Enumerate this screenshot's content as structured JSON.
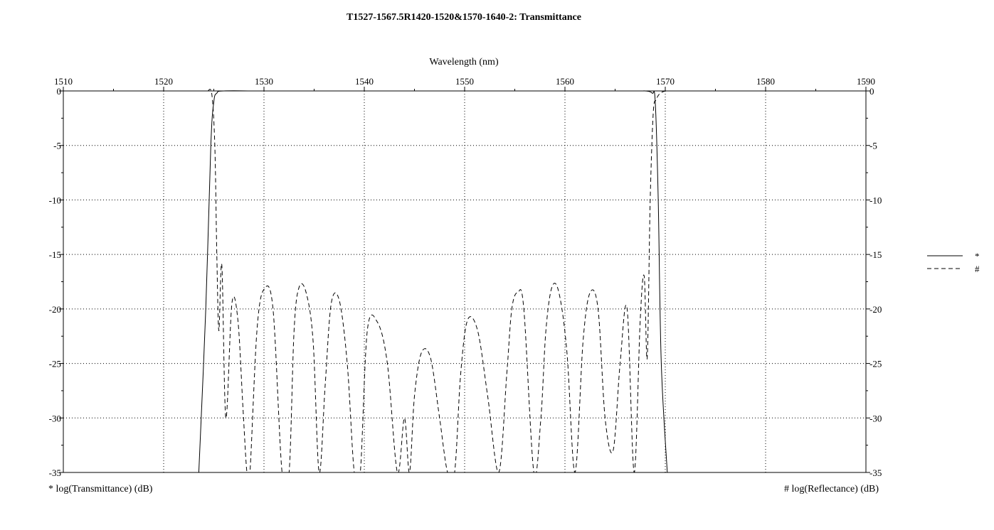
{
  "chart_data": {
    "type": "line",
    "title": "T1527-1567.5R1420-1520&1570-1640-2: Transmittance",
    "xlabel": "Wavelength (nm)",
    "ylabel_left": "* log(Transmittance) (dB)",
    "ylabel_right": "# log(Reflectance) (dB)",
    "xlim": [
      1510,
      1590
    ],
    "ylim": [
      -35,
      0
    ],
    "x_ticks": [
      1510,
      1520,
      1530,
      1540,
      1550,
      1560,
      1570,
      1580,
      1590
    ],
    "y_ticks": [
      0,
      -5,
      -10,
      -15,
      -20,
      -25,
      -30,
      -35
    ],
    "grid": true,
    "legend_position": "right",
    "series": [
      {
        "name": "*",
        "style": "solid",
        "color": "#000000",
        "x": [
          1523.5,
          1524.2,
          1524.7,
          1525.0,
          1525.3,
          1526.0,
          1530,
          1540,
          1550,
          1560,
          1567.0,
          1568.0,
          1568.7,
          1569.0,
          1569.3,
          1569.6,
          1570.2
        ],
        "y": [
          -35,
          -20,
          -5,
          -1,
          -0.2,
          0,
          0,
          0,
          0,
          0,
          0,
          0,
          -0.2,
          -1,
          -10,
          -25,
          -35
        ]
      },
      {
        "name": "#",
        "style": "dashed",
        "color": "#000000",
        "x": [
          1524.4,
          1524.8,
          1525.1,
          1525.3,
          1525.5,
          1525.8,
          1526.2,
          1526.8,
          1527.4,
          1527.9,
          1528.3,
          1528.6,
          1529.3,
          1530.0,
          1530.9,
          1531.8,
          1532.5,
          1533.0,
          1533.5,
          1534.2,
          1534.9,
          1535.5,
          1536.1,
          1536.7,
          1537.5,
          1538.3,
          1539.0,
          1539.6,
          1540.3,
          1541.3,
          1542.3,
          1543.3,
          1544.0,
          1544.5,
          1545.0,
          1545.7,
          1546.6,
          1547.5,
          1548.3,
          1549.0,
          1549.6,
          1550.3,
          1551.3,
          1552.3,
          1553.4,
          1554.2,
          1554.7,
          1555.3,
          1555.9,
          1556.9,
          1557.6,
          1558.1,
          1558.7,
          1559.4,
          1560.2,
          1561.0,
          1561.8,
          1562.5,
          1563.3,
          1564.0,
          1564.8,
          1565.5,
          1566.2,
          1566.9,
          1567.5,
          1567.9,
          1568.2,
          1568.5,
          1568.8,
          1569.1,
          1569.4,
          1569.7,
          1570.0
        ],
        "y": [
          0,
          -0.3,
          -5,
          -15,
          -22,
          -16,
          -30,
          -19.5,
          -21,
          -29,
          -35,
          -35,
          -22,
          -18.2,
          -20,
          -35,
          -35,
          -22,
          -18,
          -18.5,
          -23,
          -35,
          -27,
          -19.5,
          -19.2,
          -25,
          -35,
          -35,
          -22,
          -21.2,
          -25,
          -35,
          -30,
          -35,
          -28,
          -24,
          -24.5,
          -30,
          -35,
          -35,
          -26,
          -21,
          -22,
          -28,
          -35,
          -26,
          -20,
          -18.5,
          -20,
          -35,
          -30,
          -22,
          -18,
          -18.5,
          -24,
          -35,
          -23,
          -18.5,
          -20,
          -30,
          -33,
          -25,
          -20,
          -35,
          -21,
          -17,
          -24.5,
          -10,
          -2,
          -0.8,
          -0.3,
          -0.1,
          0
        ]
      }
    ]
  }
}
